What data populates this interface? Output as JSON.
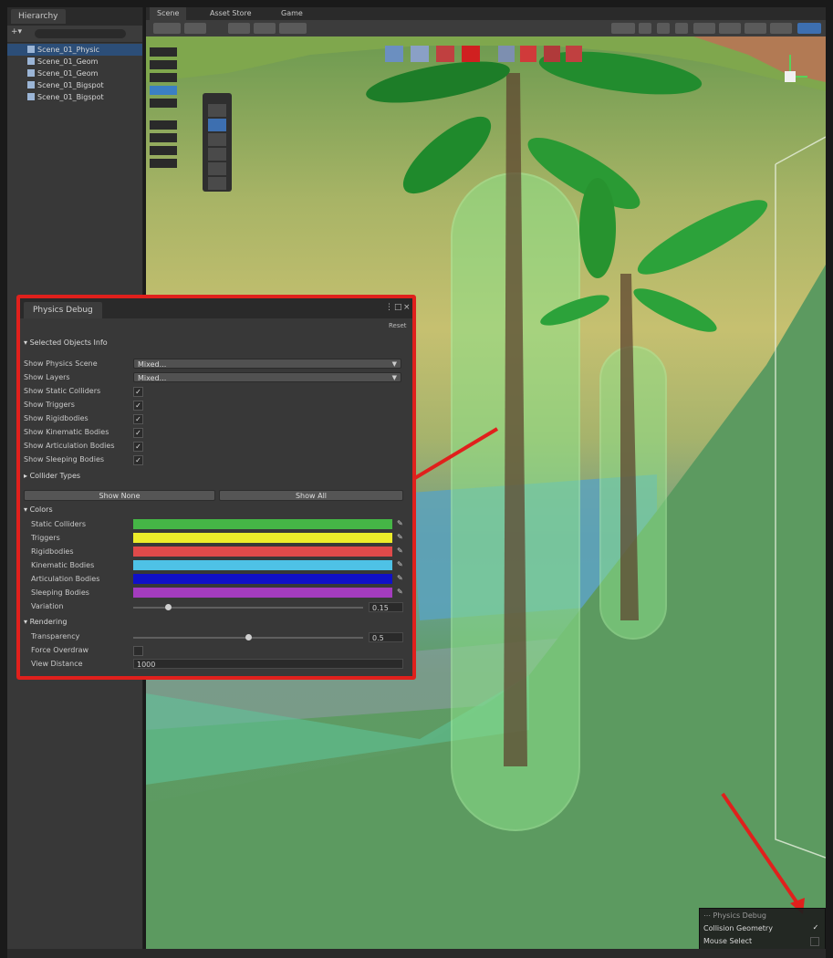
{
  "hierarchy": {
    "tab_label": "Hierarchy",
    "items": [
      {
        "label": "Scene_01_Physic"
      },
      {
        "label": "Scene_01_Geom"
      },
      {
        "label": "Scene_01_Geom"
      },
      {
        "label": "Scene_01_Bigspot"
      },
      {
        "label": "Scene_01_Bigspot"
      }
    ]
  },
  "scene": {
    "tabs": [
      "Scene",
      "Asset Store",
      "Game"
    ]
  },
  "physics_debug": {
    "tab_label": "Physics Debug",
    "reset_label": "Reset",
    "selected_objects_label": "Selected Objects Info",
    "show_physics_scene_label": "Show Physics Scene",
    "show_physics_scene_value": "Mixed...",
    "show_layers_label": "Show Layers",
    "show_layers_value": "Mixed...",
    "toggles": [
      {
        "label": "Show Static Colliders",
        "checked": true
      },
      {
        "label": "Show Triggers",
        "checked": true
      },
      {
        "label": "Show Rigidbodies",
        "checked": true
      },
      {
        "label": "Show Kinematic Bodies",
        "checked": true
      },
      {
        "label": "Show Articulation Bodies",
        "checked": true
      },
      {
        "label": "Show Sleeping Bodies",
        "checked": true
      }
    ],
    "collider_types_label": "Collider Types",
    "show_none_label": "Show None",
    "show_all_label": "Show All",
    "colors_label": "Colors",
    "colors": [
      {
        "label": "Static Colliders",
        "color": "#45b646"
      },
      {
        "label": "Triggers",
        "color": "#ecec2a"
      },
      {
        "label": "Rigidbodies",
        "color": "#e04a4a"
      },
      {
        "label": "Kinematic Bodies",
        "color": "#4ec2e6"
      },
      {
        "label": "Articulation Bodies",
        "color": "#1010c8"
      },
      {
        "label": "Sleeping Bodies",
        "color": "#a43cbf"
      }
    ],
    "variation_label": "Variation",
    "variation_value": "0.15",
    "variation_level": 0.15,
    "rendering_label": "Rendering",
    "transparency_label": "Transparency",
    "transparency_value": "0.5",
    "transparency_level": 0.5,
    "force_overdraw_label": "Force Overdraw",
    "view_distance_label": "View Distance",
    "view_distance_value": "1000"
  },
  "overlay": {
    "title": "Physics Debug",
    "collision_geometry_label": "Collision Geometry",
    "collision_geometry_checked": true,
    "mouse_select_label": "Mouse Select"
  },
  "accent_color": "#e0201c"
}
